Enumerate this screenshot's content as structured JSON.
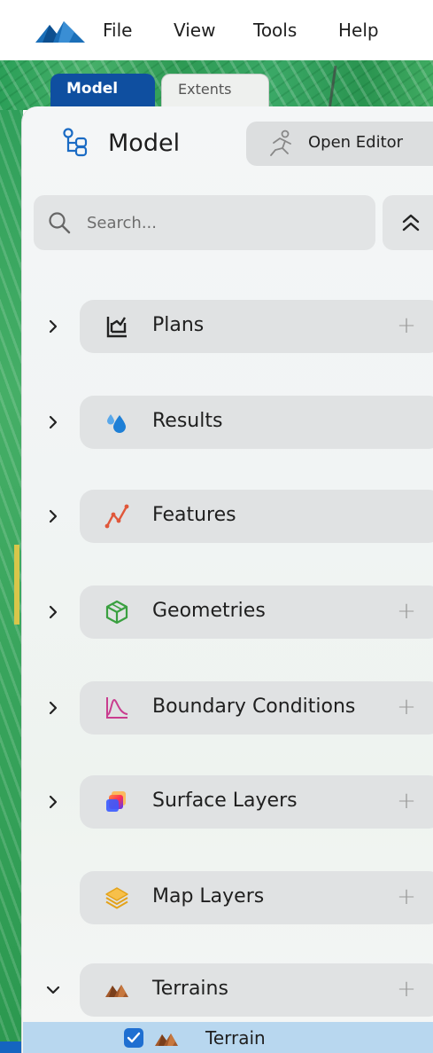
{
  "menubar": {
    "logo_icon": "mountain-logo-icon",
    "items": [
      "File",
      "View",
      "Tools",
      "Help"
    ]
  },
  "tabs": [
    {
      "label": "Model",
      "active": true
    },
    {
      "label": "Extents",
      "active": false
    }
  ],
  "panel": {
    "icon": "tree-structure-icon",
    "title": "Model",
    "open_editor": {
      "label": "Open Editor",
      "icon": "runner-icon"
    },
    "search": {
      "placeholder": "Search..."
    },
    "collapse_icon": "double-chevron-up-icon"
  },
  "tree": [
    {
      "label": "Plans",
      "icon": "plans-chart-icon",
      "expanded": false,
      "has_add": true
    },
    {
      "label": "Results",
      "icon": "water-drops-icon",
      "expanded": false,
      "has_add": false
    },
    {
      "label": "Features",
      "icon": "polyline-icon",
      "expanded": false,
      "has_add": false
    },
    {
      "label": "Geometries",
      "icon": "cube-icon",
      "expanded": false,
      "has_add": true
    },
    {
      "label": "Boundary Conditions",
      "icon": "hydrograph-icon",
      "expanded": false,
      "has_add": true
    },
    {
      "label": "Surface Layers",
      "icon": "gradient-layers-icon",
      "expanded": false,
      "has_add": true
    },
    {
      "label": "Map Layers",
      "icon": "layer-stack-icon",
      "expanded": null,
      "has_add": true
    },
    {
      "label": "Terrains",
      "icon": "terrain-icon",
      "expanded": true,
      "has_add": true
    }
  ],
  "terrain_children": [
    {
      "label": "Terrain",
      "checked": true,
      "icon": "terrain-icon"
    }
  ],
  "add_symbol": "+",
  "colors": {
    "accent": "#0f4fa0",
    "selection": "#b8d7ef",
    "checkbox": "#1f6fd1",
    "map_green": "#2e9a54"
  }
}
